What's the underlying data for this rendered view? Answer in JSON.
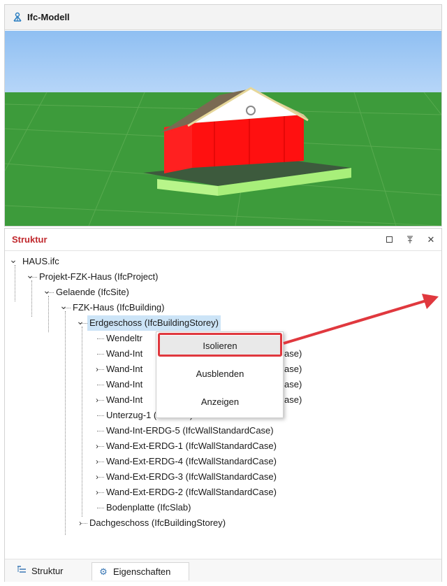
{
  "model_panel": {
    "title": "Ifc-Modell",
    "icon": "ifc-model-icon"
  },
  "structure_panel": {
    "title": "Struktur",
    "header_buttons": [
      {
        "name": "maximize-icon",
        "glyph": "□"
      },
      {
        "name": "pin-icon",
        "glyph": "⊼"
      },
      {
        "name": "close-icon",
        "glyph": "✕"
      }
    ]
  },
  "tree": [
    {
      "label": "HAUS.ifc",
      "twisty": "expanded"
    },
    {
      "label": "Projekt-FZK-Haus (IfcProject)",
      "twisty": "expanded"
    },
    {
      "label": "Gelaende (IfcSite)",
      "twisty": "expanded"
    },
    {
      "label": "FZK-Haus (IfcBuilding)",
      "twisty": "expanded"
    },
    {
      "label": "Erdgeschoss (IfcBuildingStorey)",
      "twisty": "expanded",
      "selected": true
    },
    {
      "label": "Wendeltr",
      "twisty": "none"
    },
    {
      "label": "Wand-Int",
      "suffix": "ase)",
      "twisty": "none"
    },
    {
      "label": "Wand-Int",
      "suffix": "ase)",
      "twisty": "collapsed"
    },
    {
      "label": "Wand-Int",
      "suffix": "ase)",
      "twisty": "none"
    },
    {
      "label": "Wand-Int",
      "suffix": "ase)",
      "twisty": "collapsed"
    },
    {
      "label": "Unterzug-1 (IfcBeam)",
      "twisty": "none"
    },
    {
      "label": "Wand-Int-ERDG-5 (IfcWallStandardCase)",
      "twisty": "none"
    },
    {
      "label": "Wand-Ext-ERDG-1 (IfcWallStandardCase)",
      "twisty": "collapsed"
    },
    {
      "label": "Wand-Ext-ERDG-4 (IfcWallStandardCase)",
      "twisty": "collapsed"
    },
    {
      "label": "Wand-Ext-ERDG-3 (IfcWallStandardCase)",
      "twisty": "collapsed"
    },
    {
      "label": "Wand-Ext-ERDG-2 (IfcWallStandardCase)",
      "twisty": "collapsed"
    },
    {
      "label": "Bodenplatte (IfcSlab)",
      "twisty": "none"
    },
    {
      "label": "Dachgeschoss (IfcBuildingStorey)",
      "twisty": "collapsed"
    }
  ],
  "context_menu": {
    "items": [
      "Isolieren",
      "Ausblenden",
      "Anzeigen"
    ],
    "highlighted": "Isolieren"
  },
  "tabs": [
    {
      "label": "Struktur",
      "icon": "tree-icon"
    },
    {
      "label": "Eigenschaften",
      "icon": "gear-icon"
    }
  ],
  "colors": {
    "sky": "#9ec8f5",
    "ground": "#3b9b3b",
    "selection": "#cce4f7",
    "annotation": "#e0383e",
    "panel_title": "#c0282d",
    "walls_highlight": "#ff1010"
  }
}
